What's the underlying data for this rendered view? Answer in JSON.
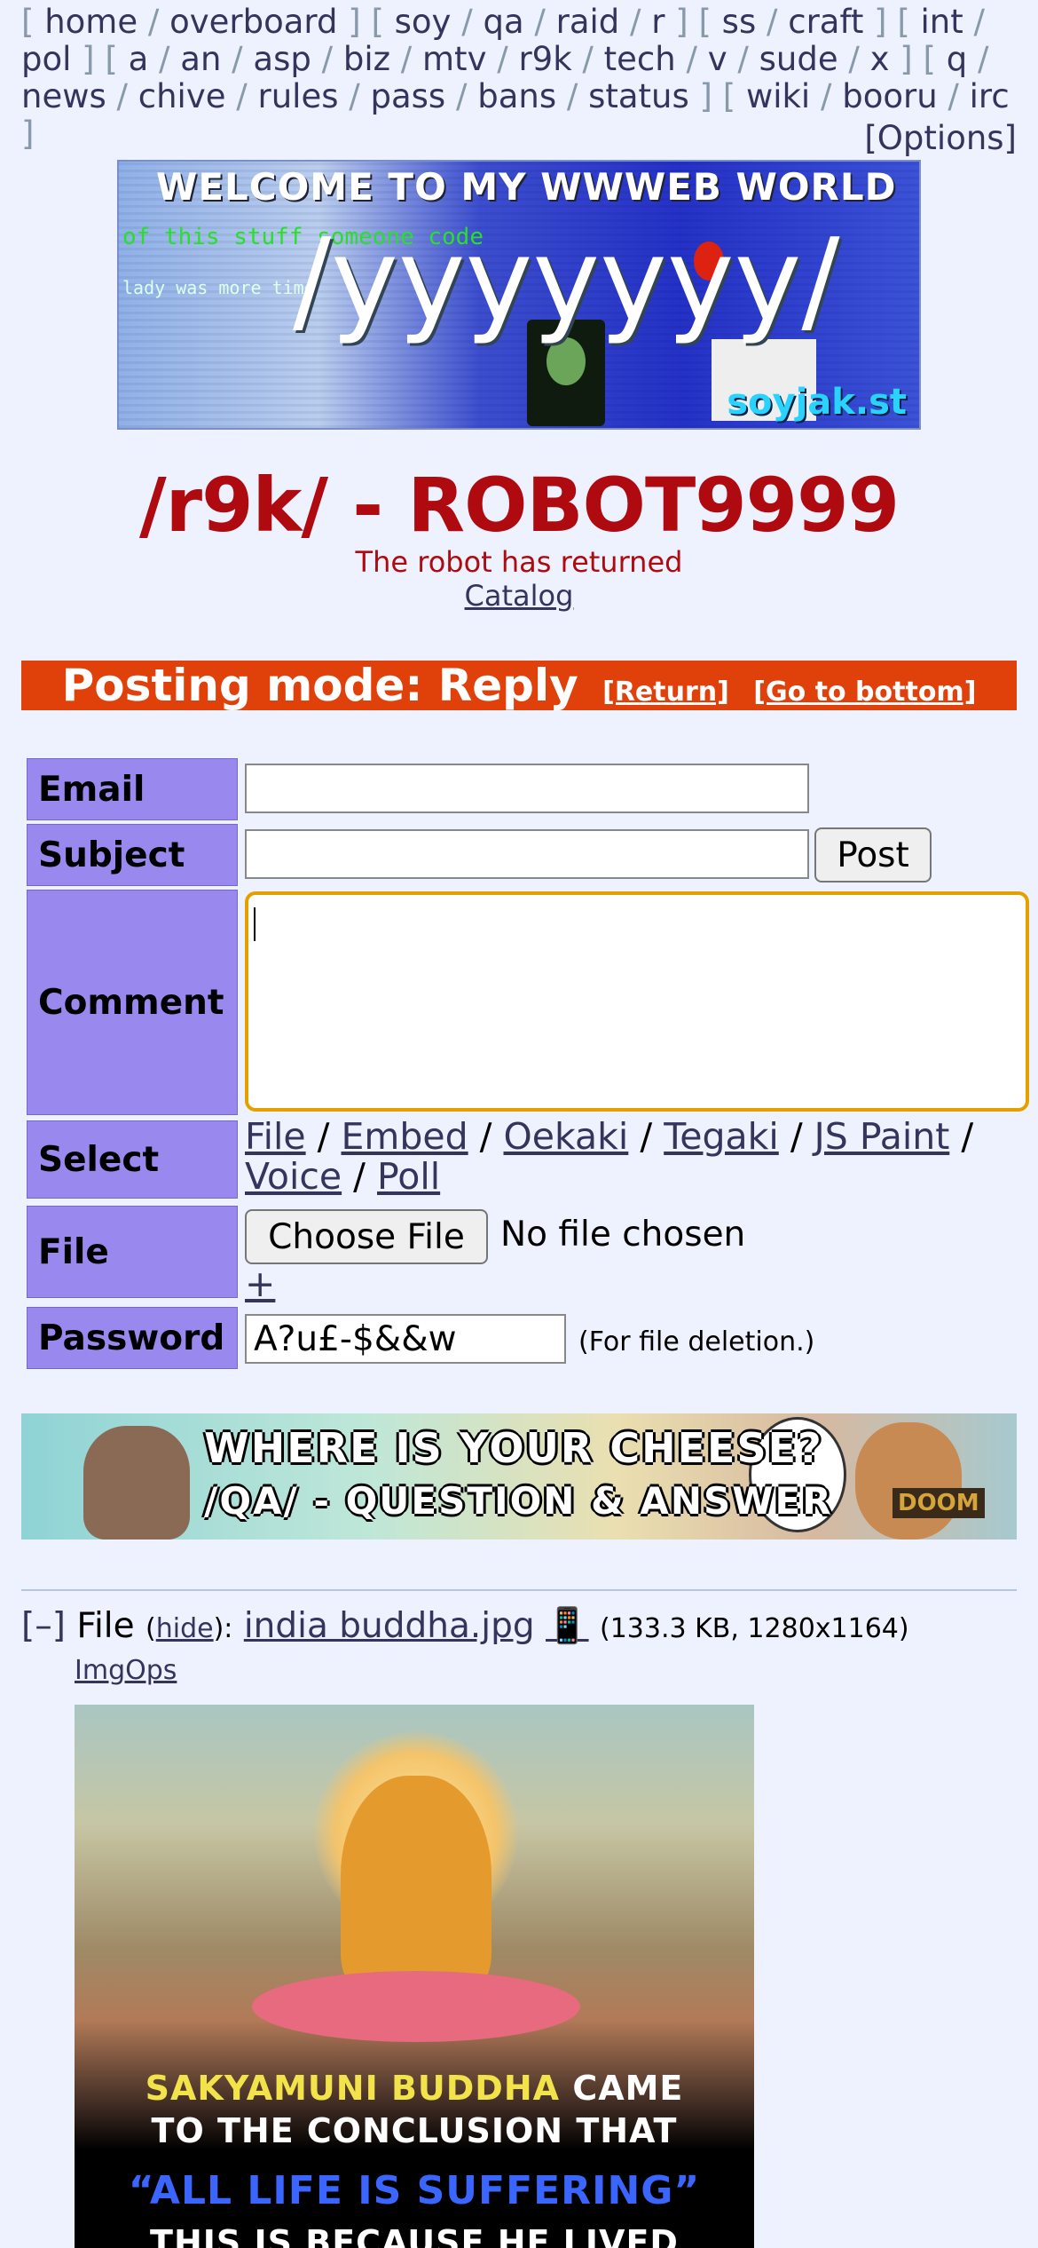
{
  "boardlist": {
    "groups": [
      [
        "home",
        "overboard"
      ],
      [
        "soy",
        "qa",
        "raid",
        "r"
      ],
      [
        "ss",
        "craft"
      ],
      [
        "int",
        "pol"
      ],
      [
        "a",
        "an",
        "asp",
        "biz",
        "mtv",
        "r9k",
        "tech",
        "v",
        "sude",
        "x"
      ],
      [
        "q",
        "news",
        "chive",
        "rules",
        "pass",
        "bans",
        "status"
      ],
      [
        "wiki",
        "booru",
        "irc"
      ]
    ],
    "options": "[Options]"
  },
  "banner": {
    "welcome": "WELCOME TO MY WWWEB WORLD",
    "big_text": "/yyyyyyy/",
    "logo": "soyjak.st"
  },
  "board": {
    "title": "/r9k/ - ROBOT9999",
    "subtitle": "The robot has returned",
    "catalog": "Catalog"
  },
  "postmode": {
    "label": "Posting mode: Reply",
    "return": "[Return]",
    "bottom": "[Go to bottom]"
  },
  "form": {
    "email_label": "Email",
    "subject_label": "Subject",
    "comment_label": "Comment",
    "select_label": "Select",
    "file_label": "File",
    "password_label": "Password",
    "post_button": "Post",
    "email_value": "",
    "subject_value": "",
    "select_links": [
      "File",
      "Embed",
      "Oekaki",
      "Tegaki",
      "JS Paint",
      "Voice",
      "Poll"
    ],
    "choose_file": "Choose File",
    "no_file": "No file chosen",
    "plus": "+",
    "password_value": "A?u£-$&&w",
    "password_note": "(For file deletion.)"
  },
  "ad": {
    "line1": "WHERE IS YOUR CHEESE?",
    "line2": "/QA/ - QUESTION & ANSWER",
    "badge": "DOOM"
  },
  "post": {
    "toggle": "[–]",
    "file_prefix": "File",
    "hide": "hide",
    "filename": "india buddha.jpg",
    "download_icon": "📱",
    "meta": "(133.3 KB, 1280x1164)",
    "imgops": "ImgOps",
    "image_text": {
      "l1a": "SAKYAMUNI BUDDHA",
      "l1b": "CAME",
      "l2": "TO THE CONCLUSION THAT",
      "l3": "“ALL LIFE IS SUFFERING”",
      "l4": "THIS IS BECAUSE HE LIVED"
    }
  },
  "colors": {
    "background": "#eef2ff",
    "title_red": "#af0a0f",
    "postmode_orange": "#e0410a",
    "label_purple": "#9988ee",
    "link": "#34345c",
    "focus_border": "#e5a000"
  }
}
